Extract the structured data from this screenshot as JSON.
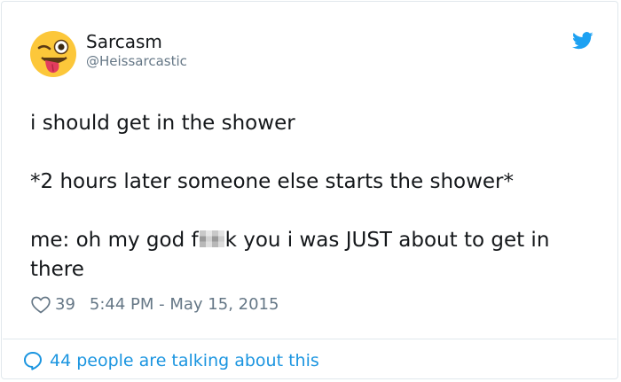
{
  "author": {
    "display_name": "Sarcasm",
    "handle": "@Heissarcastic",
    "avatar_icon": "winking-tongue-face-emoji"
  },
  "platform_icon": "twitter-bird-icon",
  "tweet": {
    "line1": "i should get in the shower",
    "line2": "*2 hours later someone else starts the shower*",
    "line3_before_censor": "me: oh my god f",
    "line3_after_censor": "k you i was JUST about to get in there"
  },
  "meta": {
    "like_count": "39",
    "timestamp": "5:44 PM - May 15, 2015"
  },
  "footer": {
    "talking_text": "44 people are talking about this"
  },
  "colors": {
    "text": "#14171a",
    "secondary": "#657786",
    "link": "#1b95e0",
    "border": "#e1e8ed",
    "emoji_yellow": "#fcc73a"
  }
}
